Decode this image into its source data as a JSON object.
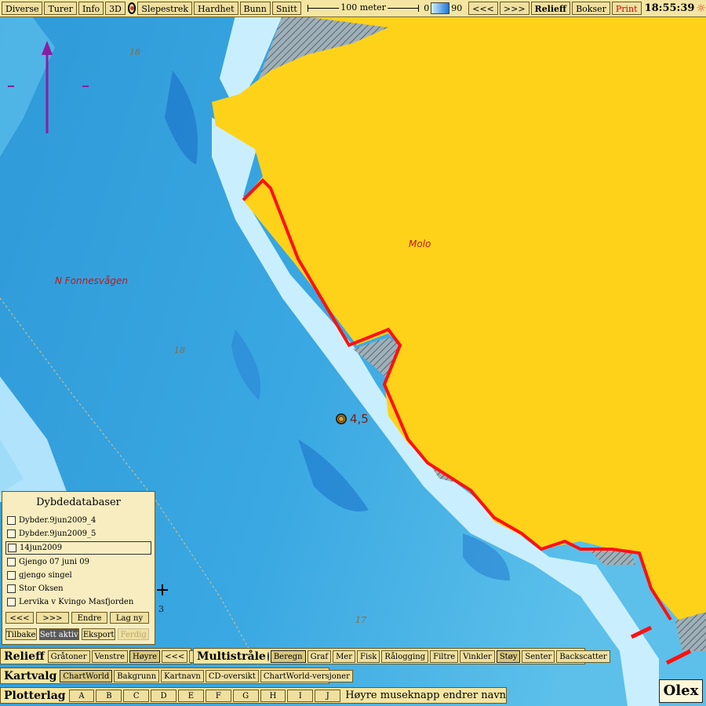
{
  "toolbar": {
    "buttons": [
      "Diverse",
      "Turer",
      "Info",
      "3D"
    ],
    "buttons2": [
      "Slepestrek",
      "Hardhet",
      "Bunn",
      "Snitt"
    ],
    "scale_label": "100 meter",
    "depth_min": "0",
    "depth_max": "90",
    "nav_prev": "<<<",
    "nav_next": ">>>",
    "relief": "Relieff",
    "bokser": "Bokser",
    "print": "Print",
    "clock": "18:55:39"
  },
  "map": {
    "land_label": "Molo",
    "water_label": "N Fonnesvågen",
    "depth_labels": [
      "18",
      "18",
      "17",
      "3"
    ],
    "marker_label": "4,5"
  },
  "panel": {
    "title": "Dybdedatabaser",
    "items": [
      {
        "label": "Dybder.9jun2009_4",
        "selected": false
      },
      {
        "label": "Dybder.9jun2009_5",
        "selected": false
      },
      {
        "label": "14jun2009",
        "selected": true
      },
      {
        "label": "Gjengo 07 juni 09",
        "selected": false
      },
      {
        "label": "gjengo singel",
        "selected": false
      },
      {
        "label": "Stor Oksen",
        "selected": false
      },
      {
        "label": "Lervika v Kvingo Masfjorden",
        "selected": false
      }
    ],
    "nav_prev": "<<<",
    "nav_next": ">>>",
    "edit": "Endre",
    "new": "Lag ny",
    "back": "Tilbake",
    "set_active": "Sett aktiv",
    "export": "Eksport",
    "done": "Ferdig"
  },
  "relief_bar": {
    "title": "Relieff",
    "buttons": [
      "Gråtoner",
      "Venstre",
      "Høyre",
      "<<<",
      ">>>"
    ],
    "active": "Høyre"
  },
  "multi_bar": {
    "title": "Multistråle",
    "buttons": [
      "Beregn",
      "Graf",
      "Mer",
      "Fisk",
      "Rålogging",
      "Filtre",
      "Vinkler",
      "Støy",
      "Senter",
      "Backscatter"
    ],
    "active": [
      "Beregn",
      "Støy"
    ]
  },
  "kartvalg_bar": {
    "title": "Kartvalg",
    "buttons": [
      "ChartWorld",
      "Bakgrunn",
      "Kartnavn",
      "CD-oversikt",
      "ChartWorld-versjoner"
    ],
    "active": "ChartWorld"
  },
  "plotter_bar": {
    "title": "Plotterlag",
    "letters": [
      "A",
      "B",
      "C",
      "D",
      "E",
      "F",
      "G",
      "H",
      "I",
      "J"
    ],
    "hint": "Høyre museknapp endrer navn"
  },
  "brand": "Olex",
  "colors": {
    "land": "#ffd21a",
    "shore_line": "#ff0000",
    "deep_water": "#1f82d6",
    "shallow_water": "#c9efff",
    "panel_bg": "#f7edc0"
  }
}
